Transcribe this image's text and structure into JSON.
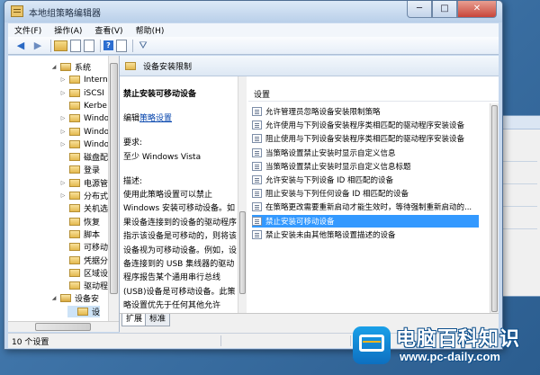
{
  "window": {
    "title": "本地组策略编辑器",
    "controls": {
      "minimize": "─",
      "maximize": "□",
      "close": "✕"
    }
  },
  "menu": [
    "文件(F)",
    "操作(A)",
    "查看(V)",
    "帮助(H)"
  ],
  "toolbar": {
    "icons": [
      "back-arrow-icon",
      "forward-arrow-icon",
      "folder-icon",
      "sheet-icon",
      "export-icon",
      "help-icon",
      "properties-icon",
      "filter-icon"
    ]
  },
  "tree": {
    "items": [
      {
        "label": "系统",
        "expander": "◢",
        "open": true
      },
      {
        "label": "Intern",
        "expander": "▷"
      },
      {
        "label": "iSCSI",
        "expander": "▷"
      },
      {
        "label": "Kerbe",
        "expander": ""
      },
      {
        "label": "Windo",
        "expander": "▷"
      },
      {
        "label": "Windo",
        "expander": "▷"
      },
      {
        "label": "Windo",
        "expander": "▷"
      },
      {
        "label": "磁盘配",
        "expander": ""
      },
      {
        "label": "登录",
        "expander": ""
      },
      {
        "label": "电源管",
        "expander": "▷"
      },
      {
        "label": "分布式",
        "expander": "▷"
      },
      {
        "label": "关机选",
        "expander": ""
      },
      {
        "label": "恢复",
        "expander": ""
      },
      {
        "label": "脚本",
        "expander": ""
      },
      {
        "label": "可移动",
        "expander": ""
      },
      {
        "label": "凭据分",
        "expander": ""
      },
      {
        "label": "区域设",
        "expander": ""
      },
      {
        "label": "驱动程",
        "expander": ""
      },
      {
        "label": "设备安",
        "expander": "◢",
        "open": true
      },
      {
        "label": "设",
        "expander": "",
        "selected": true
      }
    ]
  },
  "main": {
    "header": "设备安装限制",
    "description": {
      "title": "禁止安装可移动设备",
      "edit_prefix": "编辑",
      "edit_link": "策略设置",
      "req_label": "要求:",
      "req_value": "至少 Windows Vista",
      "desc_label": "描述:",
      "desc_body": "使用此策略设置可以禁止 Windows 安装可移动设备。如果设备连接到的设备的驱动程序指示该设备是可移动的，则将该设备视为可移动设备。例如，设备连接到的 USB 集线器的驱动程序报告某个通用串行总线(USB)设备是可移动设备。此策略设置优先于任何其他允许 Windows 安装设备的策略设置。"
    },
    "list": {
      "column": "设置",
      "rows": [
        "允许管理员忽略设备安装限制策略",
        "允许使用与下列设备安装程序类相匹配的驱动程序安装设备",
        "阻止使用与下列设备安装程序类相匹配的驱动程序安装设备",
        "当策略设置禁止安装时显示自定义信息",
        "当策略设置禁止安装时显示自定义信息标题",
        "允许安装与下列设备 ID 相匹配的设备",
        "阻止安装与下列任何设备 ID 相匹配的设备",
        "在策略更改需要重新启动才能生效时，等待强制重新启动的...",
        "禁止安装可移动设备",
        "禁止安装未由其他策略设置描述的设备"
      ],
      "selected_index": 8
    },
    "tabs": [
      "扩展",
      "标准"
    ]
  },
  "status": {
    "text": "10 个设置"
  },
  "watermark": {
    "brand": "电脑百科知识",
    "url": "www.pc-daily.com"
  },
  "colors": {
    "selection": "#3399ff",
    "titlebar": "#c6d8ee"
  }
}
